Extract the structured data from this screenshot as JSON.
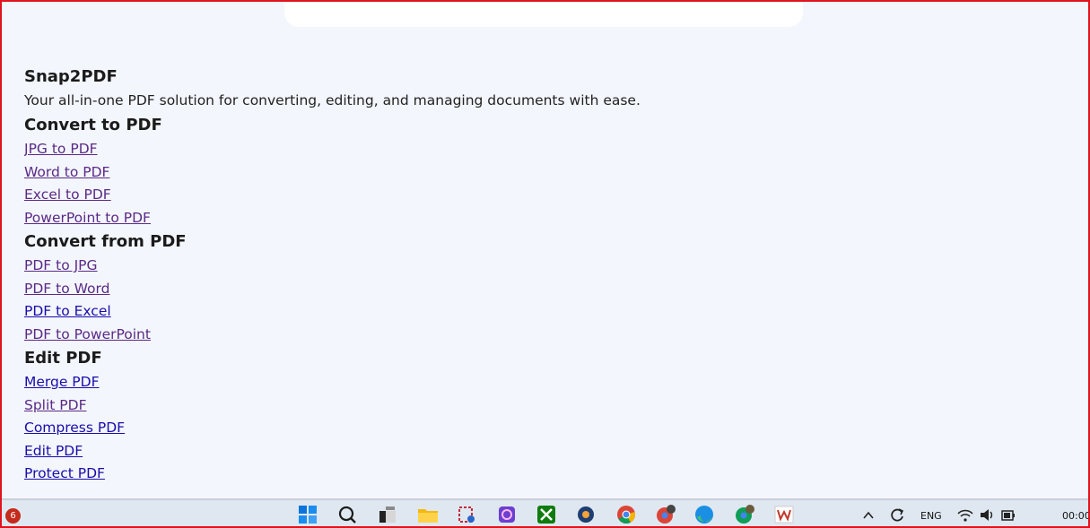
{
  "site": {
    "brand": "Snap2PDF",
    "tagline": "Your all-in-one PDF solution for converting, editing, and managing documents with ease."
  },
  "sections": [
    {
      "title": "Convert to PDF",
      "links": [
        "JPG to PDF",
        "Word to PDF",
        "Excel to PDF",
        "PowerPoint to PDF"
      ]
    },
    {
      "title": "Convert from PDF",
      "links": [
        "PDF to JPG",
        "PDF to Word",
        "PDF to Excel",
        "PDF to PowerPoint"
      ]
    },
    {
      "title": "Edit PDF",
      "links": [
        "Merge PDF",
        "Split PDF",
        "Compress PDF",
        "Edit PDF",
        "Protect PDF"
      ]
    }
  ],
  "taskbar": {
    "notification_count": "6",
    "language": "ENG",
    "time": "00:00",
    "icons": [
      "start-icon",
      "search-icon",
      "task-view-icon",
      "file-explorer-icon",
      "snipping-tool-icon",
      "app-icon",
      "xbox-icon",
      "media-icon",
      "chrome-icon",
      "chrome-profile-icon",
      "edge-icon",
      "chrome-profile-2-icon",
      "wps-icon"
    ]
  },
  "colors": {
    "page_bg": "#f3f6fc",
    "visited_link": "#5b2a86",
    "unvisited_link": "#1a0dab",
    "frame_border": "#e0141e"
  }
}
